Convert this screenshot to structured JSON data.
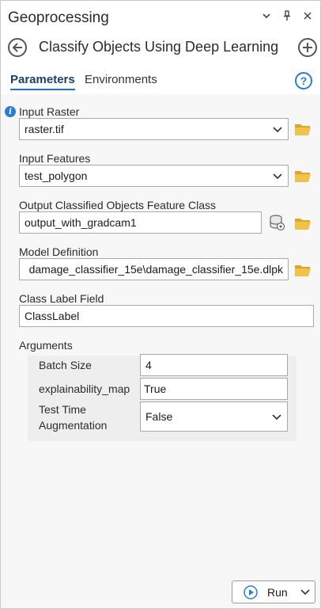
{
  "pane": {
    "title": "Geoprocessing",
    "tool_title": "Classify Objects Using Deep Learning"
  },
  "tabs": {
    "parameters": "Parameters",
    "environments": "Environments"
  },
  "params": {
    "input_raster": {
      "label": "Input Raster",
      "value": "raster.tif"
    },
    "input_features": {
      "label": "Input Features",
      "value": "test_polygon"
    },
    "output_fc": {
      "label": "Output Classified Objects Feature Class",
      "value": "output_with_gradcam1"
    },
    "model_def": {
      "label": "Model Definition",
      "value": "damage_classifier_15e\\damage_classifier_15e.dlpk"
    },
    "class_label": {
      "label": "Class Label Field",
      "value": "ClassLabel"
    }
  },
  "arguments": {
    "label": "Arguments",
    "batch_size": {
      "label": "Batch Size",
      "value": "4"
    },
    "explainability_map": {
      "label": "explainability_map",
      "value": "True"
    },
    "tta": {
      "label_line1": "Test Time",
      "label_line2": "Augmentation",
      "value": "False"
    }
  },
  "run": {
    "label": "Run"
  },
  "colors": {
    "accent": "#1f6fc5",
    "folder": "#e8b838",
    "info": "#2b7cd3"
  }
}
